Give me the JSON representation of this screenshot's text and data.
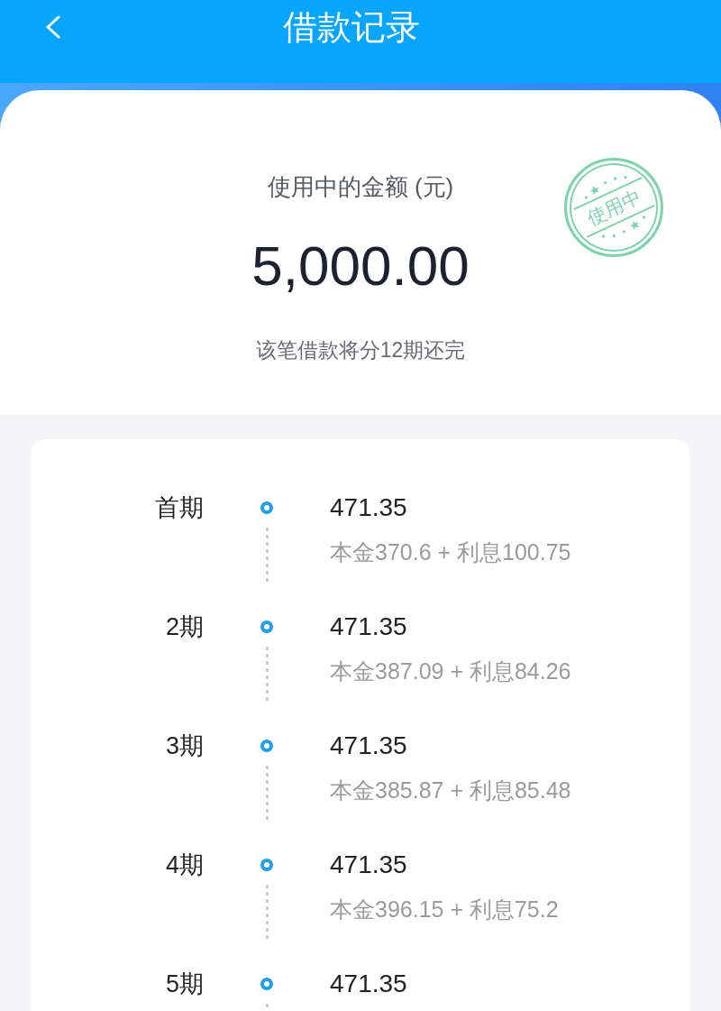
{
  "header": {
    "title": "借款记录"
  },
  "summary": {
    "label": "使用中的金额 (元)",
    "amount": "5,000.00",
    "note": "该笔借款将分12期还完",
    "stamp": "使用中"
  },
  "schedule": [
    {
      "period": "首期",
      "amount": "471.35",
      "detail": "本金370.6 + 利息100.75"
    },
    {
      "period": "2期",
      "amount": "471.35",
      "detail": "本金387.09 + 利息84.26"
    },
    {
      "period": "3期",
      "amount": "471.35",
      "detail": "本金385.87 + 利息85.48"
    },
    {
      "period": "4期",
      "amount": "471.35",
      "detail": "本金396.15 + 利息75.2"
    },
    {
      "period": "5期",
      "amount": "471.35"
    }
  ]
}
